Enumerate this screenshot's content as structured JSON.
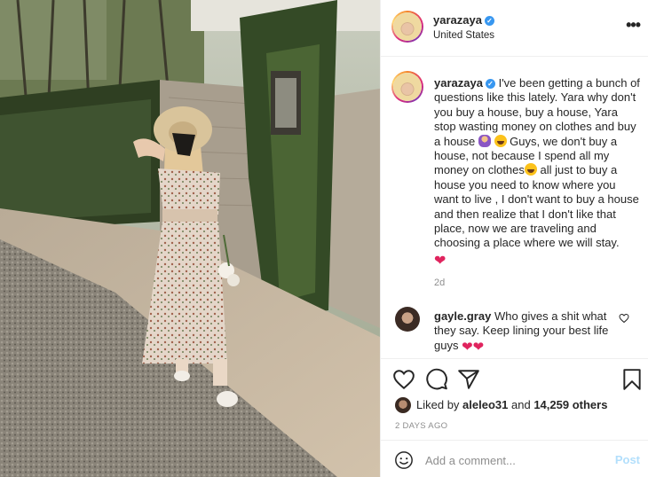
{
  "post_header": {
    "username": "yarazaya",
    "location": "United States",
    "more_icon": "more-horizontal-icon"
  },
  "caption": {
    "username": "yarazaya",
    "text_part1": "I've been getting a bunch of questions like this lately. Yara why don't you buy a house, buy a house, Yara stop wasting money on clothes and buy a house",
    "text_part2": "Guys, we don't buy a house, not because I spend all my money on clothes",
    "text_part3": "all just to buy a house you need to know where you want to live , I don't want to buy a house and then realize that I don't like that place, now we are traveling and choosing a place where we will stay.",
    "heart": "❤",
    "time": "2d"
  },
  "comment": {
    "username": "gayle.gray",
    "text": "Who gives a shit what they say. Keep lining your best life guys",
    "hearts": "❤❤"
  },
  "likes": {
    "prefix": "Liked by",
    "user": "aleleo31",
    "middle": "and",
    "count": "14,259 others"
  },
  "post_date": "2 DAYS AGO",
  "add_comment": {
    "placeholder": "Add a comment...",
    "post_label": "Post"
  },
  "icons": {
    "like": "heart-outline-icon",
    "comment": "comment-bubble-icon",
    "share": "paper-plane-icon",
    "save": "bookmark-icon",
    "emoji": "smiley-icon"
  },
  "colors": {
    "verified": "#3897f0",
    "heart": "#e0245e",
    "post_button": "#b2dffc",
    "muted_text": "#8e8e8e"
  }
}
